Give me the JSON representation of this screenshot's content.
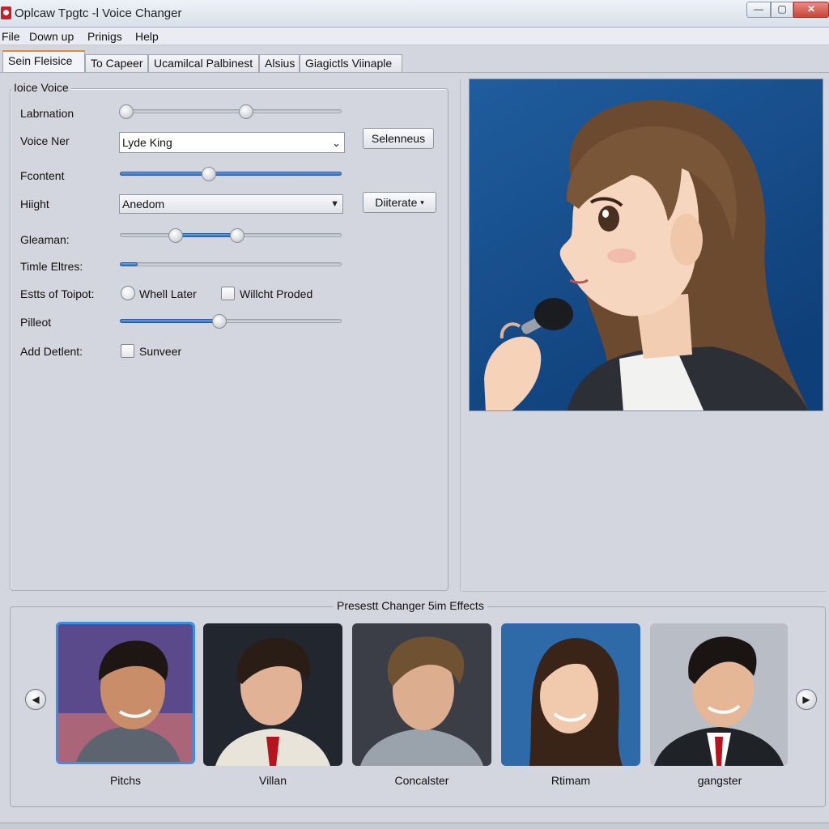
{
  "window": {
    "title": "Oplcaw Tpgtc -l Voice Changer",
    "minimize": "—",
    "maximize": "▢",
    "close": "✕"
  },
  "menu": [
    "File",
    "Down up",
    "Prinigs",
    "Help"
  ],
  "tabs": [
    {
      "label": "Sein Fleisice",
      "active": true
    },
    {
      "label": "To Capeer",
      "active": false
    },
    {
      "label": "Ucamilcal Palbinest",
      "active": false
    },
    {
      "label": "Alsius",
      "active": false
    },
    {
      "label": "Giagictls Viinaple",
      "active": false
    }
  ],
  "voice_panel": {
    "title": "Ioice Voice",
    "labrnation": {
      "label": "Labrnation",
      "low": 0.03,
      "high": 0.57
    },
    "voice_ner": {
      "label": "Voice Ner",
      "value": "Lyde King",
      "button": "Selenneus"
    },
    "fcontent": {
      "label": "Fcontent",
      "value": 0.4
    },
    "hight": {
      "label": "Hiight",
      "value": "Anedom",
      "button": "Diiterate"
    },
    "gleaman": {
      "label": "Gleaman:",
      "low": 0.25,
      "high": 0.53
    },
    "timle_eltres": {
      "label": "Timle Eltres:",
      "value": 0.08
    },
    "estts_of_toipot": {
      "label": "Estts of Toipot:",
      "radio_label": "Whell Later",
      "checkbox_label": "Willcht Proded"
    },
    "pilleot": {
      "label": "Pilleot",
      "value": 0.45
    },
    "add_detlent": {
      "label": "Add Detlent:",
      "checkbox_label": "Sunveer"
    }
  },
  "presets": {
    "title": "Presestt Changer 5im Effects",
    "items": [
      {
        "label": "Pitchs",
        "selected": true,
        "bg": "#5a4a8c",
        "skin": "#c98d6a",
        "hair": "#1d1612"
      },
      {
        "label": "Villan",
        "selected": false,
        "bg": "#22262f",
        "skin": "#e2b296",
        "hair": "#2a1d16"
      },
      {
        "label": "Concalster",
        "selected": false,
        "bg": "#3b3e46",
        "skin": "#dcae8f",
        "hair": "#6e5232"
      },
      {
        "label": "Rtimam",
        "selected": false,
        "bg": "#2e6aa8",
        "skin": "#f1c9ac",
        "hair": "#3a2418"
      },
      {
        "label": "gangster",
        "selected": false,
        "bg": "#b9bdc5",
        "skin": "#e6b796",
        "hair": "#1a1512"
      }
    ]
  },
  "colors": {
    "accent": "#3d8ee6",
    "slider_fill": "#2e6fc0",
    "close": "#c9463a"
  }
}
